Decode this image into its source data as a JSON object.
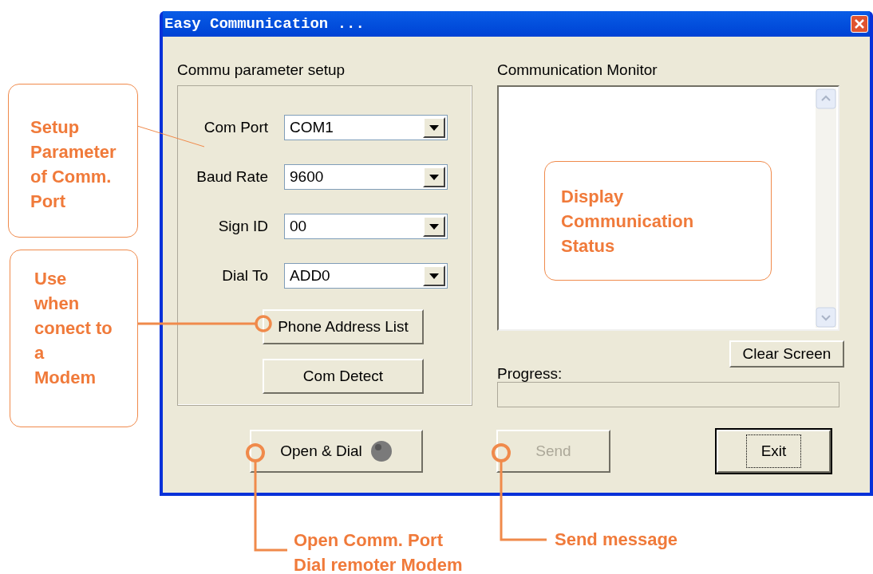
{
  "window": {
    "title": "Easy Communication ..."
  },
  "setup": {
    "heading": "Commu parameter setup",
    "fields": [
      {
        "label": "Com Port",
        "value": "COM1"
      },
      {
        "label": "Baud Rate",
        "value": "9600"
      },
      {
        "label": "Sign ID",
        "value": "00"
      },
      {
        "label": "Dial To",
        "value": "ADD0"
      }
    ],
    "buttons": [
      "Phone Address List",
      "Com Detect"
    ]
  },
  "monitor": {
    "heading": "Communication Monitor",
    "clear_button": "Clear Screen",
    "progress_label": "Progress:"
  },
  "footer_buttons": [
    {
      "label": "Open & Dial",
      "kind": "led",
      "disabled": false,
      "focused": false
    },
    {
      "label": "Send",
      "kind": "plain",
      "disabled": true,
      "focused": false
    },
    {
      "label": "Exit",
      "kind": "plain",
      "disabled": false,
      "focused": true
    }
  ],
  "callouts": [
    {
      "text": "Setup\nParameter\nof Comm.\nPort",
      "kind": "box"
    },
    {
      "text": "Use\nwhen\nconect to\na\nModem",
      "kind": "box"
    },
    {
      "text": "Display\nCommunication\nStatus",
      "kind": "box"
    },
    {
      "text": "Open Comm. Port\nDial remoter Modem",
      "kind": "plain"
    },
    {
      "text": "Send message",
      "kind": "plain"
    }
  ]
}
